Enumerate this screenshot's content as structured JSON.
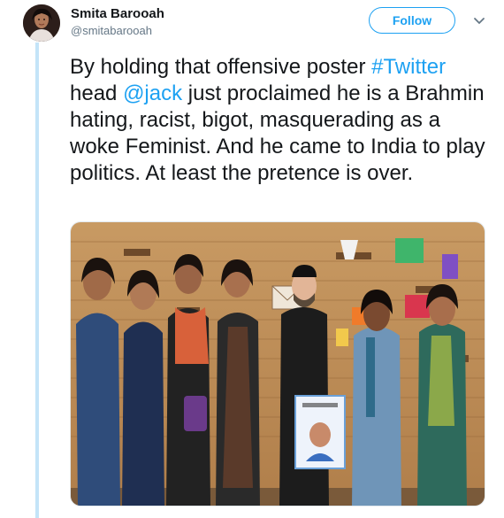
{
  "tweet": {
    "author_name": "Smita Barooah",
    "author_handle": "@smitabarooah",
    "follow_label": "Follow",
    "text_parts": [
      {
        "text": "By holding that offensive poster ",
        "type": "text"
      },
      {
        "text": "#Twitter",
        "type": "hashtag"
      },
      {
        "text": " head ",
        "type": "text"
      },
      {
        "text": "@jack",
        "type": "mention"
      },
      {
        "text": " just proclaimed he is a Brahmin hating, racist, bigot, masquerading as a woke Feminist. And he came to India to play politics. At least the pretence is over.",
        "type": "text"
      }
    ]
  },
  "icons": {
    "avatar": "profile-photo",
    "caret": "chevron-down-icon"
  },
  "colors": {
    "accent": "#1da1f2",
    "thread_line": "#c4e4f8",
    "text": "#14171a",
    "muted": "#657786"
  }
}
